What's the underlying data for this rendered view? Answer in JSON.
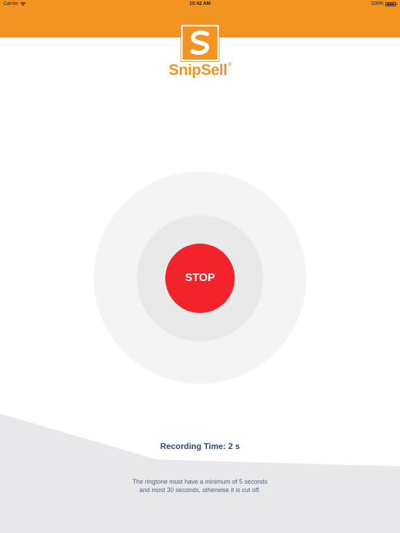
{
  "status_bar": {
    "carrier": "Carrier",
    "time": "10:42 AM",
    "battery": "100%"
  },
  "header": {
    "brand_name": "SnipSell",
    "trademark": "®"
  },
  "recorder": {
    "button_label": "STOP",
    "recording_label": "Recording Time:",
    "recording_value": "2 s"
  },
  "info": {
    "line1": "The ringtone must have a minimum of 5 seconds",
    "line2": "and most 30 seconds, otherwise it is cut off."
  },
  "colors": {
    "header_orange": "#f39420",
    "stop_red": "#f2232a",
    "text_navy": "#2d4a6a"
  },
  "icons": [
    "wifi-icon",
    "battery-icon",
    "snipsell-logo-icon"
  ]
}
